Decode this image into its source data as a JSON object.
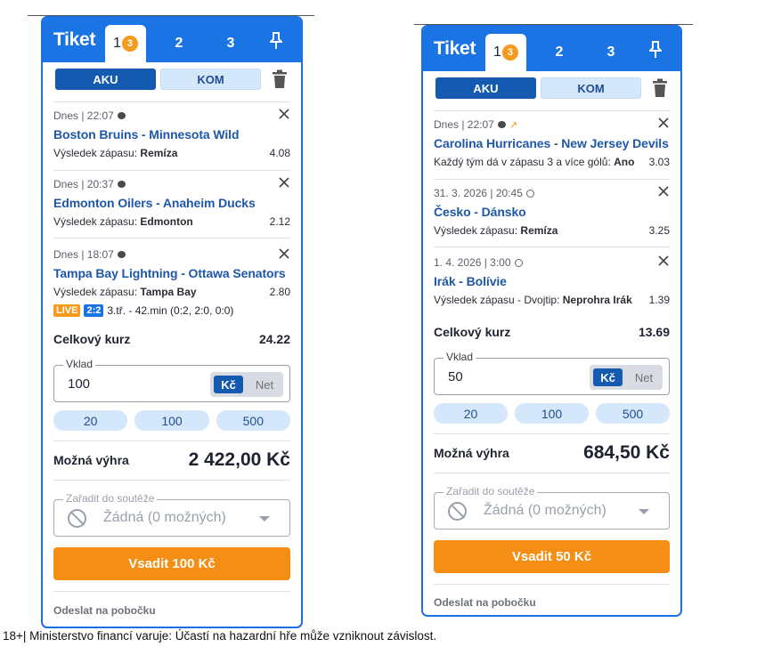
{
  "tickets": [
    {
      "title": "Tiket",
      "tabs": [
        {
          "label": "1",
          "badge": "3"
        },
        {
          "label": "2"
        },
        {
          "label": "3"
        }
      ],
      "mode": {
        "aku": "AKU",
        "kom": "KOM"
      },
      "matches": [
        {
          "meta": "Dnes | 22:07",
          "icon": "hockey-puck-icon",
          "name": "Boston Bruins - Minnesota Wild",
          "sel_prefix": "Výsledek zápasu:",
          "sel_value": "Remíza",
          "odds": "4.08"
        },
        {
          "meta": "Dnes | 20:37",
          "icon": "hockey-puck-icon",
          "name": "Edmonton Oilers - Anaheim Ducks",
          "sel_prefix": "Výsledek zápasu:",
          "sel_value": "Edmonton",
          "odds": "2.12"
        },
        {
          "meta": "Dnes | 18:07",
          "icon": "hockey-puck-icon",
          "name": "Tampa Bay Lightning - Ottawa Senators",
          "sel_prefix": "Výsledek zápasu:",
          "sel_value": "Tampa Bay",
          "odds": "2.80",
          "live": {
            "badge": "LIVE",
            "score": "2:2",
            "info": "3.tř. - 42.min (0:2, 2:0, 0:0)"
          }
        }
      ],
      "total_label": "Celkový kurz",
      "total_value": "24.22",
      "stake_label": "Vklad",
      "stake_value": "100",
      "currency_active": "Kč",
      "currency_other": "Net",
      "quick": [
        "20",
        "100",
        "500"
      ],
      "win_label": "Možná výhra",
      "win_value": "2 422,00 Kč",
      "contest_label": "Zařadit do soutěže",
      "contest_value": "Žádná (0 možných)",
      "bet_button": "Vsadit 100 Kč",
      "branch_link": "Odeslat na pobočku"
    },
    {
      "title": "Tiket",
      "tabs": [
        {
          "label": "1",
          "badge": "3"
        },
        {
          "label": "2"
        },
        {
          "label": "3"
        }
      ],
      "mode": {
        "aku": "AKU",
        "kom": "KOM"
      },
      "matches": [
        {
          "meta": "Dnes | 22:07",
          "icon": "hockey-puck-icon",
          "trend": "trend-up-icon",
          "name": "Carolina Hurricanes - New Jersey Devils",
          "sel_prefix": "Každý tým dá v zápasu 3 a více gólů:",
          "sel_value": "Ano",
          "odds": "3.03"
        },
        {
          "meta": "31. 3. 2026 | 20:45",
          "icon": "soccer-ball-icon",
          "name": "Česko - Dánsko",
          "sel_prefix": "Výsledek zápasu:",
          "sel_value": "Remíza",
          "odds": "3.25"
        },
        {
          "meta": "1. 4. 2026 | 3:00",
          "icon": "soccer-ball-icon",
          "name": "Irák - Bolívie",
          "sel_prefix": "Výsledek zápasu - Dvojtip:",
          "sel_value": "Neprohra Irák",
          "odds": "1.39"
        }
      ],
      "total_label": "Celkový kurz",
      "total_value": "13.69",
      "stake_label": "Vklad",
      "stake_value": "50",
      "currency_active": "Kč",
      "currency_other": "Net",
      "quick": [
        "20",
        "100",
        "500"
      ],
      "win_label": "Možná výhra",
      "win_value": "684,50 Kč",
      "contest_label": "Zařadit do soutěže",
      "contest_value": "Žádná (0 možných)",
      "bet_button": "Vsadit 50 Kč",
      "branch_link": "Odeslat na pobočku"
    }
  ],
  "footer_note": "18+| Ministerstvo financí varuje: Účastí na hazardní hře může vzniknout závislost.",
  "colors": {
    "brand_blue": "#1a74e4",
    "accent_orange": "#f58e14",
    "link_blue": "#1e57a8"
  }
}
